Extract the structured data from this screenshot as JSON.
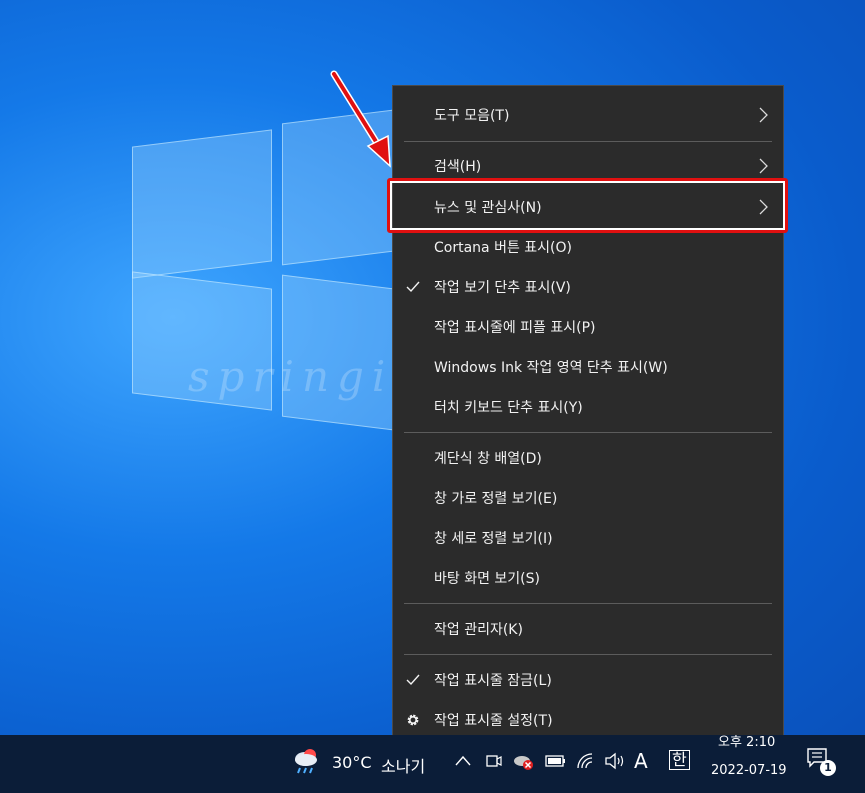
{
  "menu": {
    "items": [
      {
        "label": "도구 모음(T)",
        "submenu": true,
        "checked": false
      },
      {
        "label": "검색(H)",
        "submenu": true,
        "checked": false
      },
      {
        "label": "뉴스 및 관심사(N)",
        "submenu": true,
        "checked": false,
        "highlighted": true
      },
      {
        "label": "Cortana 버튼 표시(O)",
        "submenu": false,
        "checked": false
      },
      {
        "label": "작업 보기 단추 표시(V)",
        "submenu": false,
        "checked": true
      },
      {
        "label": "작업 표시줄에 피플 표시(P)",
        "submenu": false,
        "checked": false
      },
      {
        "label": "Windows Ink 작업 영역 단추 표시(W)",
        "submenu": false,
        "checked": false
      },
      {
        "label": "터치 키보드 단추 표시(Y)",
        "submenu": false,
        "checked": false
      },
      {
        "label": "계단식 창 배열(D)",
        "submenu": false,
        "checked": false
      },
      {
        "label": "창 가로 정렬 보기(E)",
        "submenu": false,
        "checked": false
      },
      {
        "label": "창 세로 정렬 보기(I)",
        "submenu": false,
        "checked": false
      },
      {
        "label": "바탕 화면 보기(S)",
        "submenu": false,
        "checked": false
      },
      {
        "label": "작업 관리자(K)",
        "submenu": false,
        "checked": false
      },
      {
        "label": "작업 표시줄 잠금(L)",
        "submenu": false,
        "checked": true
      },
      {
        "label": "작업 표시줄 설정(T)",
        "submenu": false,
        "checked": false,
        "icon": "gear-icon"
      }
    ]
  },
  "watermark": "springit",
  "taskbar": {
    "weather_temp": "30°C",
    "weather_desc": "소나기",
    "ime_lang": "A",
    "ime_mode": "한",
    "time": "오후 2:10",
    "date": "2022-07-19",
    "notification_count": "1"
  },
  "colors": {
    "menu_bg": "#2b2b2b",
    "highlight_border": "#e01010",
    "taskbar_bg": "#0b1d38"
  }
}
